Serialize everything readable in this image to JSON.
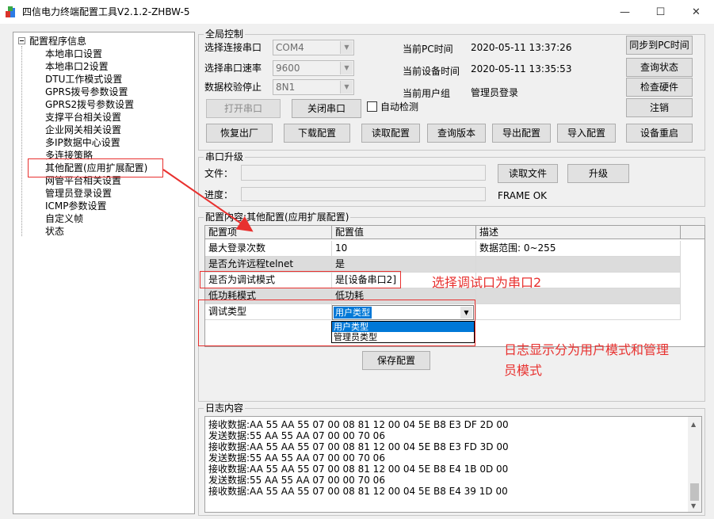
{
  "window": {
    "title": "四信电力终端配置工具V2.1.2-ZHBW-5",
    "controls": {
      "minimize": "—",
      "maximize": "☐",
      "close": "✕"
    }
  },
  "tree": {
    "root": "配置程序信息",
    "items": [
      "本地串口设置",
      "本地串口2设置",
      "DTU工作模式设置",
      "GPRS拨号参数设置",
      "GPRS2拨号参数设置",
      "支撑平台相关设置",
      "企业网关相关设置",
      "多IP数据中心设置",
      "多连接策略",
      "其他配置(应用扩展配置)",
      "网管平台相关设置",
      "管理员登录设置",
      "ICMP参数设置",
      "自定义帧",
      "状态"
    ]
  },
  "global": {
    "title": "全局控制",
    "port_label": "选择连接串口",
    "port_value": "COM4",
    "baud_label": "选择串口速率",
    "baud_value": "9600",
    "parity_label": "数据校验停止",
    "parity_value": "8N1",
    "pc_time_label": "当前PC时间",
    "pc_time_value": "2020-05-11 13:37:26",
    "dev_time_label": "当前设备时间",
    "dev_time_value": "2020-05-11 13:35:53",
    "user_group_label": "当前用户组",
    "user_group_value": "管理员登录",
    "open_port": "打开串口",
    "close_port": "关闭串口",
    "auto_detect": "自动检测",
    "sync_pc": "同步到PC时间",
    "query_status": "查询状态",
    "check_hw": "检查硬件",
    "logout": "注销",
    "factory": "恢复出厂",
    "download": "下载配置",
    "read_cfg": "读取配置",
    "query_ver": "查询版本",
    "export_cfg": "导出配置",
    "import_cfg": "导入配置",
    "reboot": "设备重启"
  },
  "upgrade": {
    "title": "串口升级",
    "file_label": "文件：",
    "progress_label": "进度：",
    "read_file": "读取文件",
    "upgrade_btn": "升级",
    "status": "FRAME OK"
  },
  "config": {
    "title": "配置内容:其他配置(应用扩展配置)",
    "headers": [
      "配置项",
      "配置值",
      "描述"
    ],
    "rows": [
      {
        "item": "最大登录次数",
        "value": "10",
        "desc": "数据范围: 0~255"
      },
      {
        "item": "是否允许远程telnet",
        "value": "是",
        "desc": ""
      },
      {
        "item": "是否为调试模式",
        "value": "是[设备串口2]",
        "desc": ""
      },
      {
        "item": "低功耗模式",
        "value": "低功耗",
        "desc": ""
      },
      {
        "item": "调试类型",
        "value": "用户类型",
        "desc": ""
      }
    ],
    "dropdown_options": [
      "用户类型",
      "管理员类型"
    ],
    "save": "保存配置"
  },
  "log": {
    "title": "日志内容",
    "lines": [
      "接收数据:AA 55 AA 55 07 00 08 81 12 00 04 5E B8 E3 DF 2D 00",
      "发送数据:55 AA 55 AA 07 00 00 70 06",
      "接收数据:AA 55 AA 55 07 00 08 81 12 00 04 5E B8 E3 FD 3D 00",
      "发送数据:55 AA 55 AA 07 00 00 70 06",
      "接收数据:AA 55 AA 55 07 00 08 81 12 00 04 5E B8 E4 1B 0D 00",
      "发送数据:55 AA 55 AA 07 00 00 70 06",
      "接收数据:AA 55 AA 55 07 00 08 81 12 00 04 5E B8 E4 39 1D 00"
    ]
  },
  "annotations": {
    "debug_port": "选择调试口为串口2",
    "log_mode_line1": "日志显示分为用户模式和管理",
    "log_mode_line2": "员模式",
    "color": "#e8312f"
  }
}
